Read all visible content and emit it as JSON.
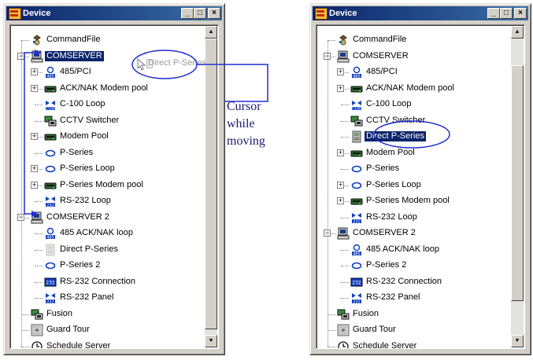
{
  "window_title": "Device",
  "titlebar_buttons": [
    "_",
    "□",
    "×"
  ],
  "left_tree": {
    "items": [
      {
        "label": "CommandFile",
        "icon": "command-file-icon"
      },
      {
        "label": "COMSERVER",
        "icon": "server-computer-icon"
      },
      {
        "label": "485/PCI",
        "icon": "485-pci-icon"
      },
      {
        "label": "ACK/NAK Modem pool",
        "icon": "modem-pool-icon"
      },
      {
        "label": "C-100 Loop",
        "icon": "c100-loop-icon"
      },
      {
        "label": "CCTV Switcher",
        "icon": "cctv-switcher-icon"
      },
      {
        "label": "Modem Pool",
        "icon": "modem-pool-icon"
      },
      {
        "label": "P-Series",
        "icon": "p-series-icon"
      },
      {
        "label": "P-Series Loop",
        "icon": "p-series-icon"
      },
      {
        "label": "P-Series Modem pool",
        "icon": "modem-pool-icon"
      },
      {
        "label": "RS-232 Loop",
        "icon": "rs232-loop-icon"
      },
      {
        "label": "COMSERVER 2",
        "icon": "server-computer-icon"
      },
      {
        "label": "485 ACK/NAK loop",
        "icon": "485-loop-icon"
      },
      {
        "label": "Direct P-Series",
        "icon": "direct-p-series-icon"
      },
      {
        "label": "P-Series 2",
        "icon": "p-series-icon"
      },
      {
        "label": "RS-232 Connection",
        "icon": "rs232-connection-icon"
      },
      {
        "label": "RS-232 Panel",
        "icon": "rs232-panel-icon"
      },
      {
        "label": "Fusion",
        "icon": "fusion-icon"
      },
      {
        "label": "Guard Tour",
        "icon": "guard-tour-icon"
      },
      {
        "label": "Schedule Server",
        "icon": "clock-icon"
      }
    ],
    "drag_ghost_label": "Direct P-Series"
  },
  "right_tree": {
    "items": [
      {
        "label": "CommandFile",
        "icon": "command-file-icon"
      },
      {
        "label": "COMSERVER",
        "icon": "server-computer-icon"
      },
      {
        "label": "485/PCI",
        "icon": "485-pci-icon"
      },
      {
        "label": "ACK/NAK Modem pool",
        "icon": "modem-pool-icon"
      },
      {
        "label": "C-100 Loop",
        "icon": "c100-loop-icon"
      },
      {
        "label": "CCTV Switcher",
        "icon": "cctv-switcher-icon"
      },
      {
        "label": "Direct P-Series",
        "icon": "direct-p-series-icon"
      },
      {
        "label": "Modem Pool",
        "icon": "modem-pool-icon"
      },
      {
        "label": "P-Series",
        "icon": "p-series-icon"
      },
      {
        "label": "P-Series Loop",
        "icon": "p-series-icon"
      },
      {
        "label": "P-Series Modem pool",
        "icon": "modem-pool-icon"
      },
      {
        "label": "RS-232 Loop",
        "icon": "rs232-loop-icon"
      },
      {
        "label": "COMSERVER 2",
        "icon": "server-computer-icon"
      },
      {
        "label": "485 ACK/NAK loop",
        "icon": "485-loop-icon"
      },
      {
        "label": "P-Series 2",
        "icon": "p-series-icon"
      },
      {
        "label": "RS-232 Connection",
        "icon": "rs232-connection-icon"
      },
      {
        "label": "RS-232 Panel",
        "icon": "rs232-panel-icon"
      },
      {
        "label": "Fusion",
        "icon": "fusion-icon"
      },
      {
        "label": "Guard Tour",
        "icon": "guard-tour-icon"
      },
      {
        "label": "Schedule Server",
        "icon": "clock-icon"
      }
    ]
  },
  "annotation": {
    "line1": "Cursor",
    "line2": "while",
    "line3": "moving"
  },
  "colors": {
    "selection": "#0a246a",
    "annotation_blue": "#1f2fd0",
    "titlebar_start": "#0a246a",
    "titlebar_end": "#3a6ea5"
  }
}
